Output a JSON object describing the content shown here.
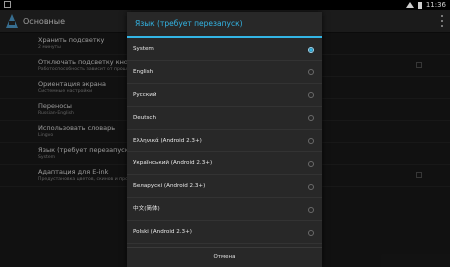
{
  "status_bar": {
    "time": "11:36"
  },
  "action_bar": {
    "title": "Основные"
  },
  "settings": [
    {
      "title": "Хранить подсветку",
      "summary": "2 минуты"
    },
    {
      "title": "Отключать подсветку кнопок",
      "summary": "Работоспособность зависит от прошивки",
      "checkbox": true
    },
    {
      "title": "Ориентация экрана",
      "summary": "Системные настройки"
    },
    {
      "title": "Переносы",
      "summary": "Russian-English"
    },
    {
      "title": "Использовать словарь",
      "summary": "Lingvo"
    },
    {
      "title": "Язык (требует перезапуск)",
      "summary": "System"
    },
    {
      "title": "Адаптация для E-ink",
      "summary": "Предустановка цветов, скинов и прочих",
      "checkbox": true
    }
  ],
  "dialog": {
    "title": "Язык (требует перезапуск)",
    "options": [
      {
        "label": "System",
        "selected": true
      },
      {
        "label": "English",
        "selected": false
      },
      {
        "label": "Русский",
        "selected": false
      },
      {
        "label": "Deutsch",
        "selected": false
      },
      {
        "label": "Ελληνικά (Android 2.3+)",
        "selected": false
      },
      {
        "label": "Український (Android 2.3+)",
        "selected": false
      },
      {
        "label": "Беларускі (Android 2.3+)",
        "selected": false
      },
      {
        "label": "中文(简体)",
        "selected": false
      },
      {
        "label": "Polski (Android 2.3+)",
        "selected": false
      }
    ],
    "cancel_label": "Отмена"
  },
  "colors": {
    "accent": "#33b5e5",
    "background": "#1b1b1b",
    "dialog": "#282828"
  },
  "icons": {
    "app": "app-logo-icon",
    "overflow": "overflow-menu-icon"
  }
}
